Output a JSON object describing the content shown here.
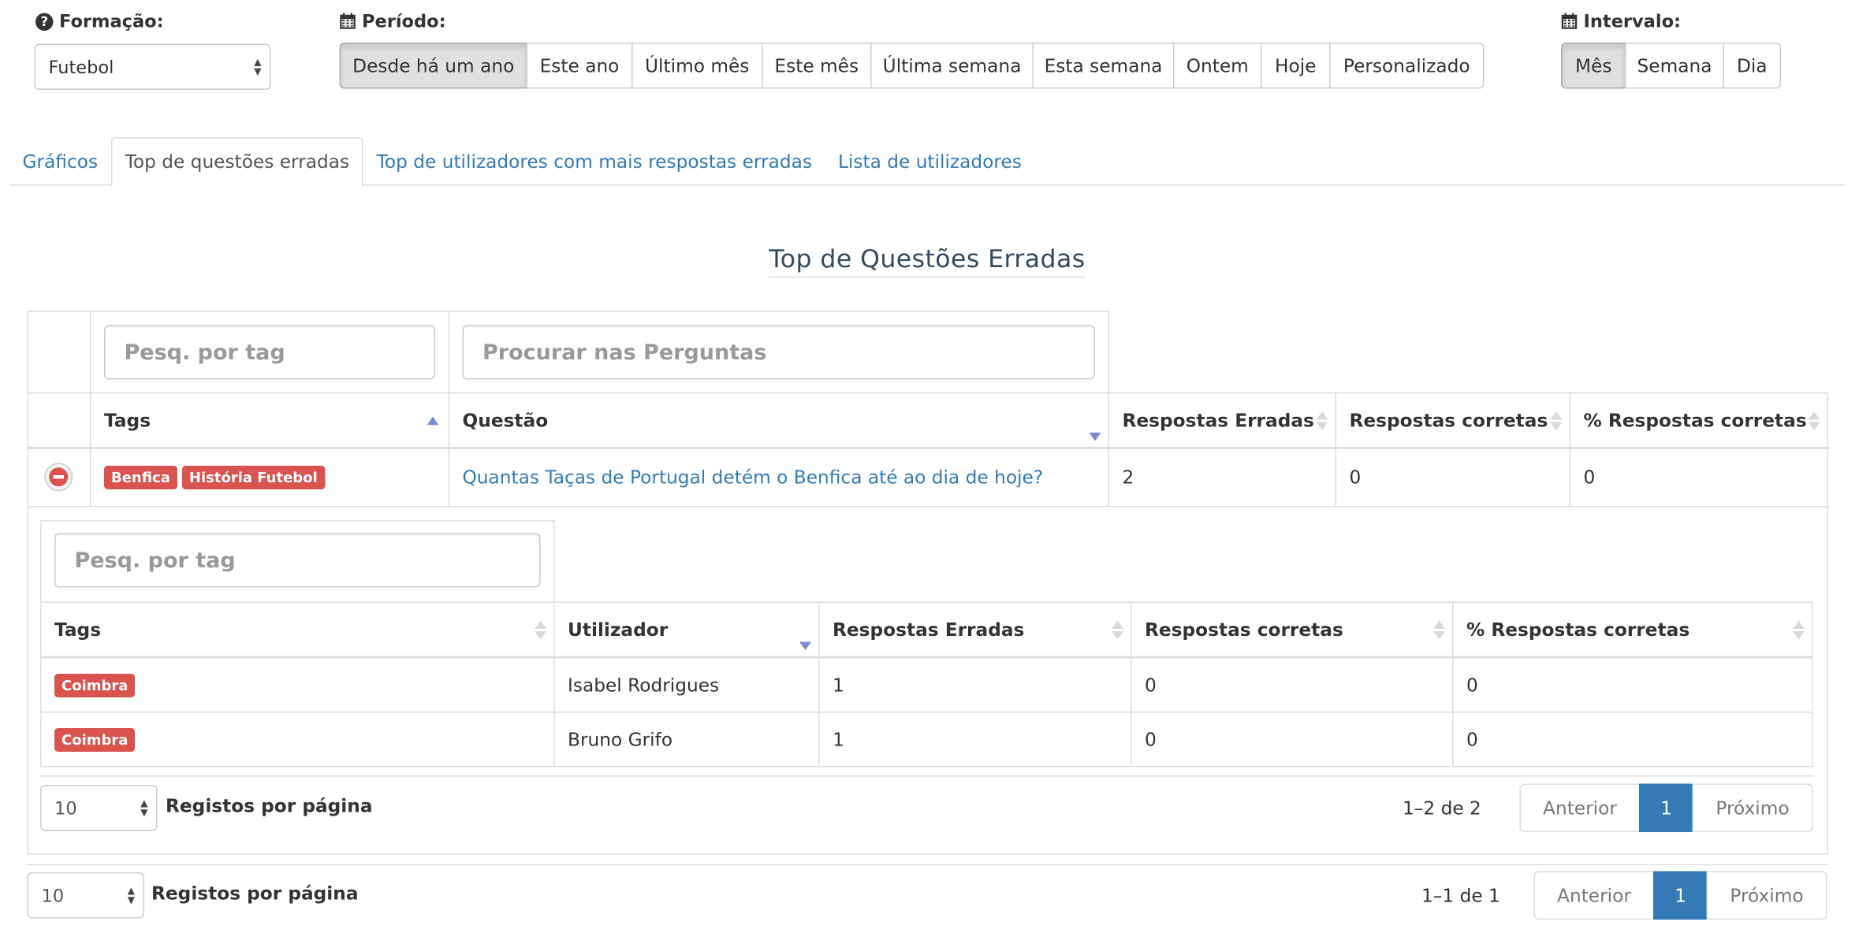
{
  "filters": {
    "formacao": {
      "label": "Formação:",
      "value": "Futebol"
    },
    "periodo": {
      "label": "Período:",
      "options": [
        "Desde há um ano",
        "Este ano",
        "Último mês",
        "Este mês",
        "Última semana",
        "Esta semana",
        "Ontem",
        "Hoje",
        "Personalizado"
      ],
      "active": "Desde há um ano"
    },
    "intervalo": {
      "label": "Intervalo:",
      "options": [
        "Mês",
        "Semana",
        "Dia"
      ],
      "active": "Mês"
    }
  },
  "tabs": [
    {
      "label": "Gráficos",
      "active": false
    },
    {
      "label": "Top de questões erradas",
      "active": true
    },
    {
      "label": "Top de utilizadores com mais respostas erradas",
      "active": false
    },
    {
      "label": "Lista de utilizadores",
      "active": false
    }
  ],
  "section_title": "Top de Questões Erradas",
  "main_table": {
    "tag_search_placeholder": "Pesq. por tag",
    "question_search_placeholder": "Procurar nas Perguntas",
    "columns": [
      "Tags",
      "Questão",
      "Respostas Erradas",
      "Respostas corretas",
      "% Respostas corretas"
    ],
    "row": {
      "tags": [
        "Benfica",
        "História Futebol"
      ],
      "question": "Quantas Taças de Portugal detém o Benfica até ao dia de hoje?",
      "wrong": "2",
      "correct": "0",
      "pct": "0"
    },
    "footer": {
      "page_size": "10",
      "page_size_label": "Registos por página",
      "range": "1–1 de 1",
      "prev": "Anterior",
      "page": "1",
      "next": "Próximo"
    }
  },
  "sub_table": {
    "tag_search_placeholder": "Pesq. por tag",
    "columns": [
      "Tags",
      "Utilizador",
      "Respostas Erradas",
      "Respostas corretas",
      "% Respostas corretas"
    ],
    "rows": [
      {
        "tag": "Coimbra",
        "user": "Isabel Rodrigues",
        "wrong": "1",
        "correct": "0",
        "pct": "0"
      },
      {
        "tag": "Coimbra",
        "user": "Bruno Grifo",
        "wrong": "1",
        "correct": "0",
        "pct": "0"
      }
    ],
    "footer": {
      "page_size": "10",
      "page_size_label": "Registos por página",
      "range": "1–2 de 2",
      "prev": "Anterior",
      "page": "1",
      "next": "Próximo"
    }
  },
  "colors": {
    "link": "#337ab7",
    "tag": "#d9534f",
    "sort_active": "#7b89d6",
    "title": "#34495e"
  }
}
